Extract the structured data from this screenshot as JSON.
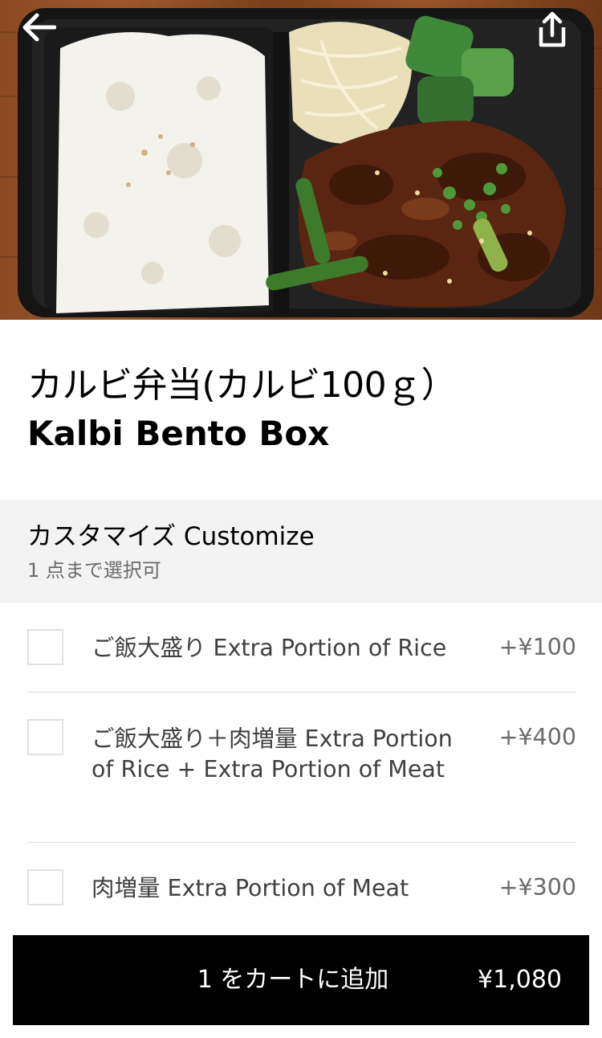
{
  "hero": {
    "image_name": "kalbi-bento-photo",
    "back_icon": "back-arrow-icon",
    "share_icon": "share-icon"
  },
  "item": {
    "title_jp": "カルビ弁当(カルビ100ｇ）",
    "title_en": "Kalbi Bento Box"
  },
  "customize": {
    "title": "カスタマイズ Customize",
    "subtitle": "1 点まで選択可",
    "options": [
      {
        "label": "ご飯大盛り Extra Portion of Rice",
        "price": "+¥100",
        "checked": false
      },
      {
        "label": "ご飯大盛り＋肉増量 Extra Portion of Rice + Extra Portion of Meat",
        "price": "+¥400",
        "checked": false
      },
      {
        "label": "肉増量 Extra Portion of Meat",
        "price": "+¥300",
        "checked": false
      }
    ]
  },
  "cart": {
    "label": "1 をカートに追加",
    "price": "¥1,080"
  },
  "colors": {
    "cart_bg": "#000000",
    "section_bg": "#f3f3f3",
    "divider": "#dedede"
  }
}
